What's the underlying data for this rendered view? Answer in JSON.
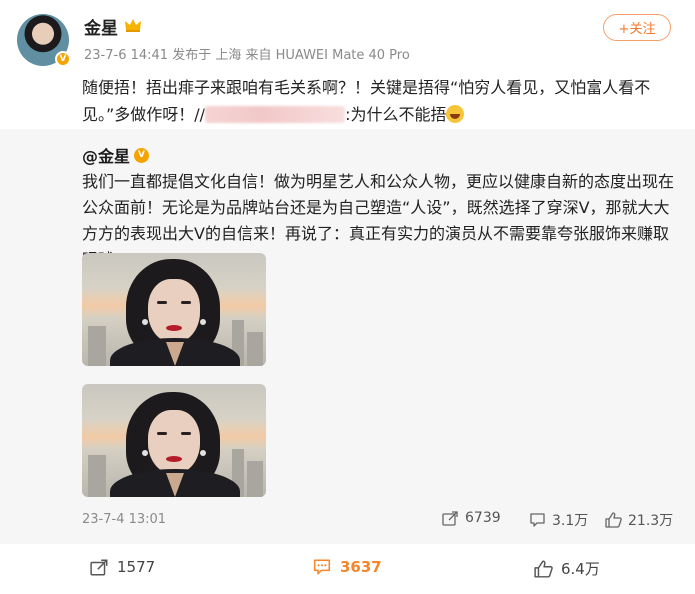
{
  "post": {
    "author": "金星",
    "meta": "23-7-6 14:41 发布于 上海 来自 HUAWEI Mate 40 Pro",
    "follow_label": "+关注",
    "text_1": "随便捂！捂出痱子来跟咱有毛关系啊？！关键是捂得“怕穷人看见，又怕富人看不见。”多做作呀！//",
    "text_2": ":为什么不能捂",
    "badge_letter": "V"
  },
  "quoted": {
    "author": "@金星",
    "badge_letter": "V",
    "text": "我们一直都提倡文化自信！做为明星艺人和公众人物，更应以健康自新的态度出现在公众面前！无论是为品牌站台还是为自己塑造“人设”，既然选择了穿深V，那就大大方方的表现出大V的自信来！再说了：真正有实力的演员从不需要靠夸张服饰来赚取眼球！",
    "date": "23-7-4 13:01",
    "forward_count": "6739",
    "comment_count": "3.1万",
    "like_count": "21.3万"
  },
  "bottom": {
    "forward_count": "1577",
    "comment_count": "3637",
    "like_count": "6.4万"
  },
  "colors": {
    "accent_orange": "#f5862b",
    "verified_gold": "#f6a300",
    "quote_bg": "#f6f6f6"
  },
  "icons": [
    "crown-icon",
    "forward-icon",
    "comment-icon",
    "like-icon",
    "laugh-emoji-icon",
    "verified-badge-icon"
  ]
}
